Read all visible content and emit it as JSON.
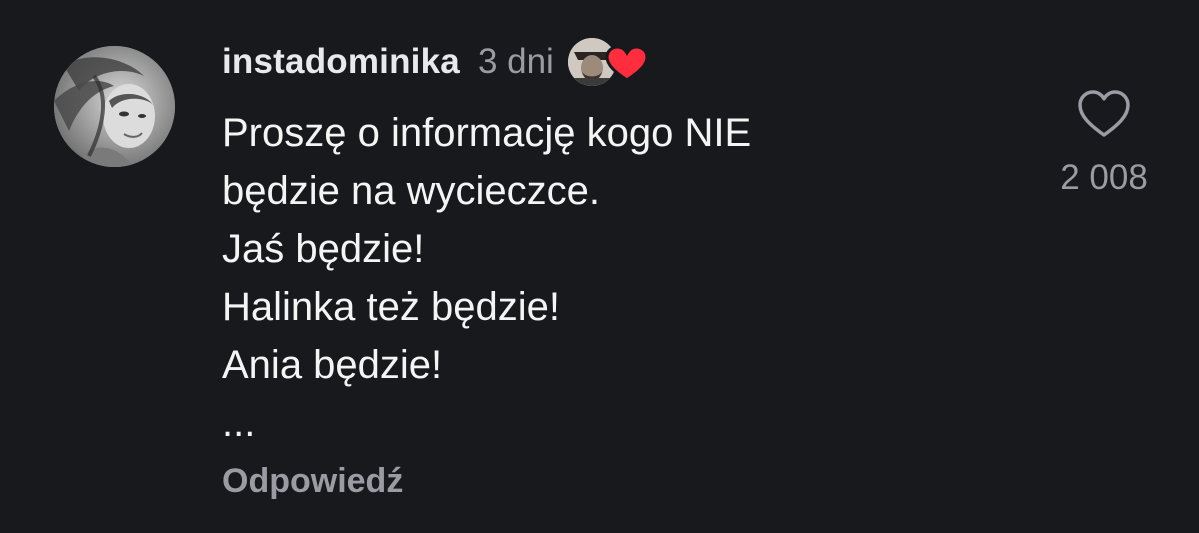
{
  "comment": {
    "username": "instadominika",
    "time": "3 dni",
    "body_lines": [
      "Proszę o informację kogo NIE",
      "będzie na wycieczce.",
      "Jaś będzie!",
      "Halinka też będzie!",
      "Ania będzie!",
      "..."
    ],
    "reply_label": "Odpowiedź",
    "like_count": "2 008",
    "liked_by_creator": true
  },
  "icons": {
    "like": "heart-outline-icon",
    "creator_like_badge": "heart-filled-icon"
  },
  "colors": {
    "background": "#18191d",
    "text_primary": "#f4f4f4",
    "text_secondary": "#9a9ba3",
    "heart_red": "#ff2d3d"
  }
}
